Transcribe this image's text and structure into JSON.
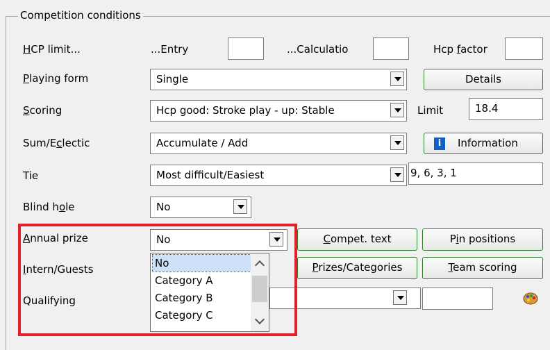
{
  "section_title": "Competition conditions",
  "labels": {
    "hcp_limit": {
      "pre": "",
      "u": "H",
      "post": "CP limit..."
    },
    "playing_form": {
      "pre": "",
      "u": "P",
      "post": "laying form"
    },
    "scoring": {
      "pre": "",
      "u": "S",
      "post": "coring"
    },
    "sum_eclectic": {
      "pre": "Sum/E",
      "u": "c",
      "post": "lectic"
    },
    "tie": {
      "pre": "Tie",
      "u": "",
      "post": ""
    },
    "blind_hole": {
      "pre": "Blind h",
      "u": "o",
      "post": "le"
    },
    "annual_prize": {
      "pre": "",
      "u": "A",
      "post": "nnual prize"
    },
    "intern_guests": {
      "pre": "",
      "u": "I",
      "post": "ntern/Guests"
    },
    "qualifying": {
      "pre": "Qualifying",
      "u": "",
      "post": ""
    }
  },
  "hcp": {
    "entry_label": "...Entry",
    "entry_value": "",
    "calculation_label": "...Calculatio",
    "calculation_value": "",
    "factor_label": {
      "pre": "Hcp ",
      "u": "f",
      "post": "actor"
    },
    "factor_value": ""
  },
  "playing_form": {
    "value": "Single",
    "details_button": "Details"
  },
  "scoring": {
    "value": "Hcp good: Stroke play - up: Stable",
    "limit_label": "Limit",
    "limit_value": "18.4"
  },
  "sum_eclectic": {
    "value": "Accumulate / Add",
    "information_button": "Information"
  },
  "tie": {
    "value": "Most difficult/Easiest",
    "sequence": "9, 6, 3, 1"
  },
  "blind_hole": {
    "value": "No"
  },
  "annual_prize": {
    "value": "No",
    "options": [
      "No",
      "Category A",
      "Category B",
      "Category C"
    ],
    "selected": "No"
  },
  "buttons": {
    "compet_text": {
      "pre": "",
      "u": "C",
      "post": "ompet. text"
    },
    "pin_positions": {
      "pre": "P",
      "u": "i",
      "post": "n positions"
    },
    "prizes_categories": {
      "pre": "",
      "u": "P",
      "post": "rizes/Categories"
    },
    "team_scoring": {
      "pre": "",
      "u": "T",
      "post": "eam scoring"
    }
  },
  "qualifying": {
    "value": "",
    "extra": ""
  },
  "colors": {
    "highlight_box": "#e0202a",
    "button_border": "#2d7d2d",
    "selection": "#cce0f8"
  }
}
